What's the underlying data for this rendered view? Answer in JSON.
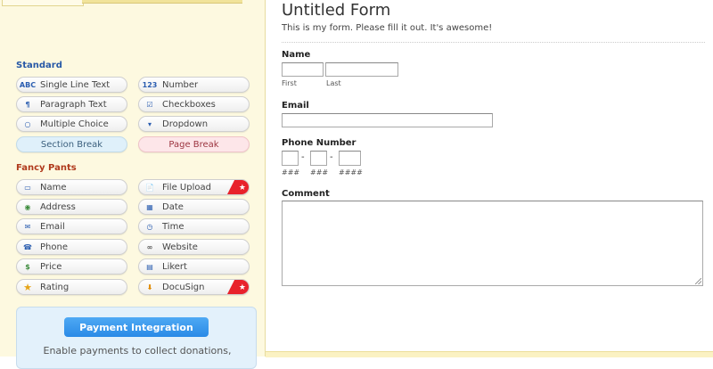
{
  "sidebar": {
    "standard_title": "Standard",
    "standard": [
      {
        "label": "Single Line Text",
        "icon": "abc-text-icon",
        "icon_text": "ABC"
      },
      {
        "label": "Number",
        "icon": "number-icon",
        "icon_text": "123"
      },
      {
        "label": "Paragraph Text",
        "icon": "paragraph-icon",
        "icon_text": "¶"
      },
      {
        "label": "Checkboxes",
        "icon": "checkbox-icon",
        "icon_text": "☑"
      },
      {
        "label": "Multiple Choice",
        "icon": "radio-icon",
        "icon_text": "○"
      },
      {
        "label": "Dropdown",
        "icon": "dropdown-icon",
        "icon_text": "▾"
      },
      {
        "label": "Section Break"
      },
      {
        "label": "Page Break"
      }
    ],
    "fancy_title": "Fancy Pants",
    "fancy": [
      {
        "label": "Name",
        "icon": "name-card-icon",
        "icon_text": "▭"
      },
      {
        "label": "File Upload",
        "icon": "file-upload-icon",
        "icon_text": "📄"
      },
      {
        "label": "Address",
        "icon": "globe-icon",
        "icon_text": "◉"
      },
      {
        "label": "Date",
        "icon": "calendar-icon",
        "icon_text": "▦"
      },
      {
        "label": "Email",
        "icon": "envelope-icon",
        "icon_text": "✉"
      },
      {
        "label": "Time",
        "icon": "clock-icon",
        "icon_text": "◷"
      },
      {
        "label": "Phone",
        "icon": "phone-icon",
        "icon_text": "☎"
      },
      {
        "label": "Website",
        "icon": "link-icon",
        "icon_text": "∞"
      },
      {
        "label": "Price",
        "icon": "money-icon",
        "icon_text": "$"
      },
      {
        "label": "Likert",
        "icon": "likert-grid-icon",
        "icon_text": "▤"
      },
      {
        "label": "Rating",
        "icon": "star-icon",
        "icon_text": "★"
      },
      {
        "label": "DocuSign",
        "icon": "docusign-icon",
        "icon_text": "⬇"
      }
    ],
    "ribbon_glyph": "★",
    "payment_button": "Payment Integration",
    "payment_desc": "Enable payments to collect donations,"
  },
  "form": {
    "title": "Untitled Form",
    "description": "This is my form. Please fill it out. It's awesome!",
    "name_label": "Name",
    "first_sublabel": "First",
    "last_sublabel": "Last",
    "email_label": "Email",
    "phone_label": "Phone Number",
    "phone_dash": "-",
    "phone_sub1": "###",
    "phone_sub2": "###",
    "phone_sub3": "####",
    "comment_label": "Comment"
  },
  "colors": {
    "sidebar_bg": "#fdf9e0",
    "standard_title": "#2658a6",
    "fancy_title": "#b03a1c",
    "ribbon_red": "#e8222b",
    "payment_blue": "#2a8ae6"
  }
}
